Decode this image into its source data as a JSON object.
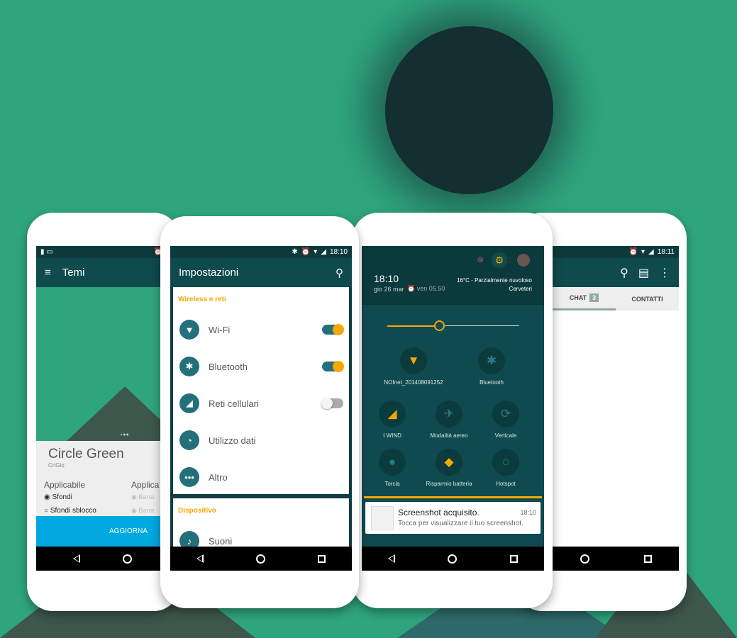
{
  "colors": {
    "background": "#2fa57d",
    "primary": "#0f4a4d",
    "accent": "#f5a800",
    "button": "#00a9e0"
  },
  "phone1": {
    "status_icons": [
      "battery-alert-icon",
      "image-icon",
      "alarm-icon"
    ],
    "title": "Temi",
    "pager_dots": 3,
    "theme_name": "Circle Green",
    "author": "CriGio",
    "col1_title": "Applicabile",
    "col2_title": "Applica",
    "options1": [
      {
        "label": "Sfondi",
        "checked": true
      },
      {
        "label": "Sfondi sblocco",
        "checked": false
      }
    ],
    "options2": [
      "Barra",
      "Barra"
    ],
    "button": "AGGIORNA"
  },
  "phone2": {
    "time": "18:10",
    "title": "Impostazioni",
    "section1": "Wireless e reti",
    "items": [
      {
        "label": "Wi-Fi",
        "icon": "wifi-icon",
        "toggle": true
      },
      {
        "label": "Bluetooth",
        "icon": "bluetooth-icon",
        "toggle": true
      },
      {
        "label": "Reti cellulari",
        "icon": "signal-icon",
        "toggle": false
      },
      {
        "label": "Utilizzo dati",
        "icon": "data-usage-icon"
      },
      {
        "label": "Altro",
        "icon": "more-icon"
      }
    ],
    "section2": "Dispositivo",
    "items2": [
      {
        "label": "Suoni",
        "icon": "bell-icon"
      }
    ]
  },
  "phone3": {
    "time": "18:10",
    "date": "gio 26 mar",
    "alarm": "ven 05.50",
    "weather": "16°C - Parzialmente nuvoloso",
    "location": "Cerveteri",
    "brightness": 0.4,
    "tiles": [
      {
        "label": "NOInet_201408091252",
        "icon": "wifi-icon"
      },
      {
        "label": "Bluetooth",
        "icon": "bluetooth-icon"
      },
      {
        "label": "I WIND",
        "icon": "signal-icon"
      },
      {
        "label": "Modalità aereo",
        "icon": "airplane-icon"
      },
      {
        "label": "Verticale",
        "icon": "rotation-lock-icon"
      },
      {
        "label": "Torcia",
        "icon": "flashlight-icon"
      },
      {
        "label": "Risparmio batteria",
        "icon": "battery-saver-icon"
      },
      {
        "label": "Hotspot",
        "icon": "hotspot-icon"
      }
    ],
    "notification": {
      "title": "Screenshot acquisito.",
      "time": "18:10",
      "text": "Tocca per visualizzare il tuo screenshot."
    }
  },
  "phone4": {
    "time": "18:11",
    "tabs": [
      {
        "label": "CHAT",
        "badge": "3"
      },
      {
        "label": "CONTATTI"
      }
    ]
  }
}
